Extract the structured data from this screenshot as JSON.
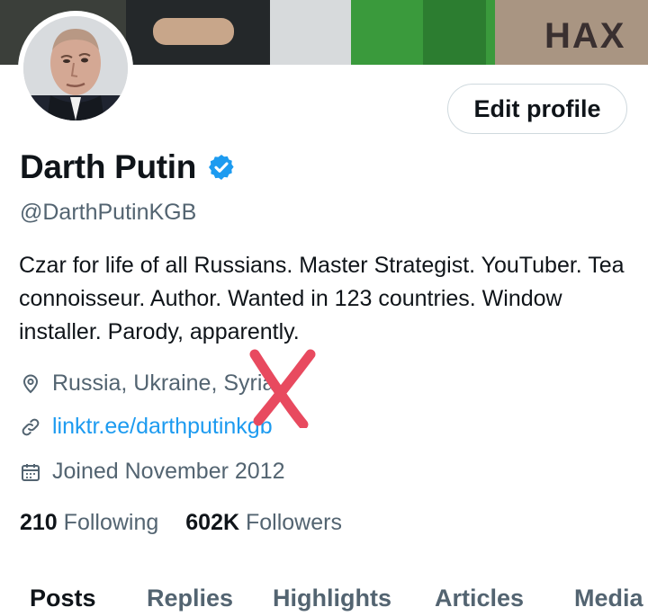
{
  "profile": {
    "name": "Darth Putin",
    "handle": "@DarthPutinKGB",
    "bio": "Czar for life of all Russians. Master Strategist. YouTuber. Tea connoisseur. Author. Wanted in 123 countries. Window installer. Parody, apparently.",
    "location": "Russia, Ukraine, Syria",
    "link": "linktr.ee/darthputinkgb",
    "joined": "Joined November 2012",
    "verified_icon": "verified-badge-icon",
    "banner_text": "НАХ"
  },
  "actions": {
    "edit_profile": "Edit profile"
  },
  "stats": {
    "following_count": "210",
    "following_label": "Following",
    "followers_count": "602K",
    "followers_label": "Followers"
  },
  "tabs": [
    {
      "label": "Posts",
      "active": true
    },
    {
      "label": "Replies",
      "active": false
    },
    {
      "label": "Highlights",
      "active": false
    },
    {
      "label": "Articles",
      "active": false
    },
    {
      "label": "Media",
      "active": false
    }
  ],
  "colors": {
    "accent": "#1d9bf0",
    "text": "#0f1419",
    "secondary": "#536471",
    "scribble": "#e84a5f"
  }
}
